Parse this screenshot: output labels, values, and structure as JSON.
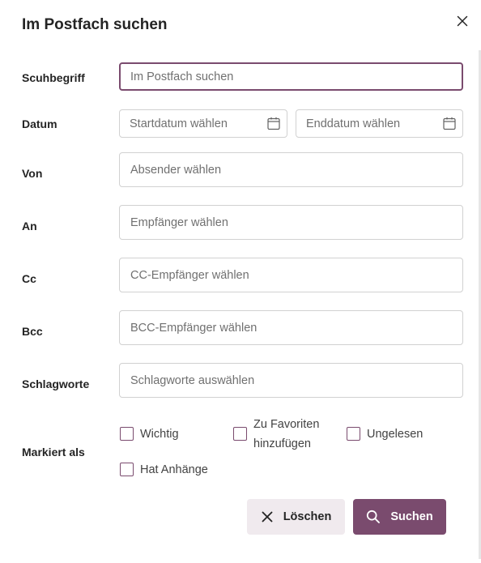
{
  "dialog": {
    "title": "Im Postfach suchen",
    "close_icon": "close-icon"
  },
  "form": {
    "search_term": {
      "label": "Scuhbegriff",
      "placeholder": "Im Postfach suchen",
      "value": ""
    },
    "date": {
      "label": "Datum",
      "start_placeholder": "Startdatum wählen",
      "end_placeholder": "Enddatum wählen",
      "icon": "calendar-icon"
    },
    "from": {
      "label": "Von",
      "placeholder": "Absender wählen"
    },
    "to": {
      "label": "An",
      "placeholder": "Empfänger wählen"
    },
    "cc": {
      "label": "Cc",
      "placeholder": "CC-Empfänger wählen"
    },
    "bcc": {
      "label": "Bcc",
      "placeholder": "BCC-Empfänger wählen"
    },
    "tags": {
      "label": "Schlagworte",
      "placeholder": "Schlagworte auswählen"
    },
    "flags": {
      "label": "Markiert als",
      "important": {
        "label": "Wichtig",
        "checked": false
      },
      "favorites": {
        "label_line1": "Zu Favoriten",
        "label_line2": "hinzufügen",
        "checked": false
      },
      "unread": {
        "label": "Ungelesen",
        "checked": false
      },
      "attachments": {
        "label": "Hat Anhänge",
        "checked": false
      }
    }
  },
  "actions": {
    "clear_label": "Löschen",
    "clear_icon": "close-icon",
    "search_label": "Suchen",
    "search_icon": "search-icon"
  },
  "colors": {
    "accent": "#7a4b6e",
    "clear_bg": "#f0eaee",
    "text": "#242424",
    "placeholder": "#707070",
    "border": "#d1d1d1"
  }
}
